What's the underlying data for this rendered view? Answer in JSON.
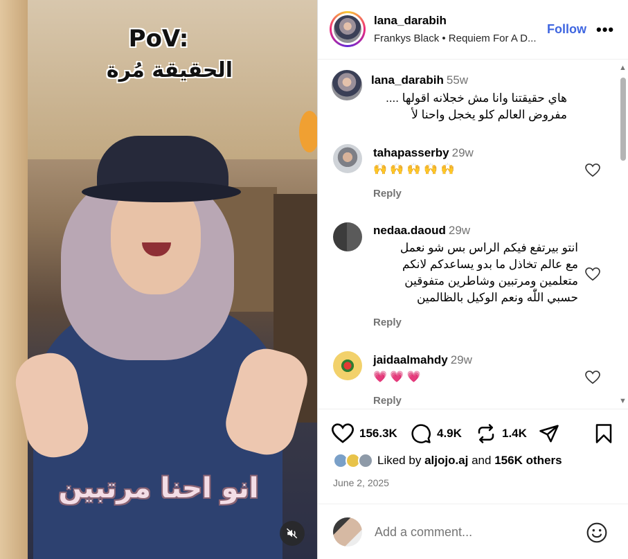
{
  "video": {
    "overlay_title": "PoV:",
    "overlay_subtitle": "الحقيقة مُرة",
    "caption": "انو احنا مرتبين"
  },
  "header": {
    "username": "lana_darabih",
    "audio": "Frankys Black • Requiem For A D...",
    "follow_label": "Follow",
    "more_label": "•••"
  },
  "comments": [
    {
      "user": "lana_darabih",
      "time": "55w",
      "lines": [
        "هاي حقيقتنا وانا مش خجلانه اقولها ....",
        "مفروض العالم كلو يخجل واحنا لأ"
      ]
    },
    {
      "user": "tahapasserby",
      "time": "29w",
      "text": "🙌 🙌 🙌 🙌 🙌",
      "reply": "Reply"
    },
    {
      "user": "nedaa.daoud",
      "time": "29w",
      "lines": [
        "انتو بيرتفع فيكم الراس بس شو نعمل",
        "مع عالم تخاذل ما بدو يساعدكم لانكم",
        "متعلمين ومرتبين وشاطرين متفوقين",
        "حسبي اللّٰه ونعم الوكيل بالظالمين"
      ],
      "reply": "Reply"
    },
    {
      "user": "jaidaalmahdy",
      "time": "29w",
      "text": "💗 💗 💗",
      "reply": "Reply"
    }
  ],
  "actions": {
    "likes": "156.3K",
    "comments": "4.9K",
    "reposts": "1.4K"
  },
  "liked_by": {
    "prefix": "Liked by",
    "user": "aljojo.aj",
    "and": "and",
    "others": "156K others"
  },
  "date": "June 2, 2025",
  "add_comment": {
    "placeholder": "Add a comment..."
  },
  "colors": {
    "follow": "#3f66e0",
    "muted": "#737373"
  }
}
